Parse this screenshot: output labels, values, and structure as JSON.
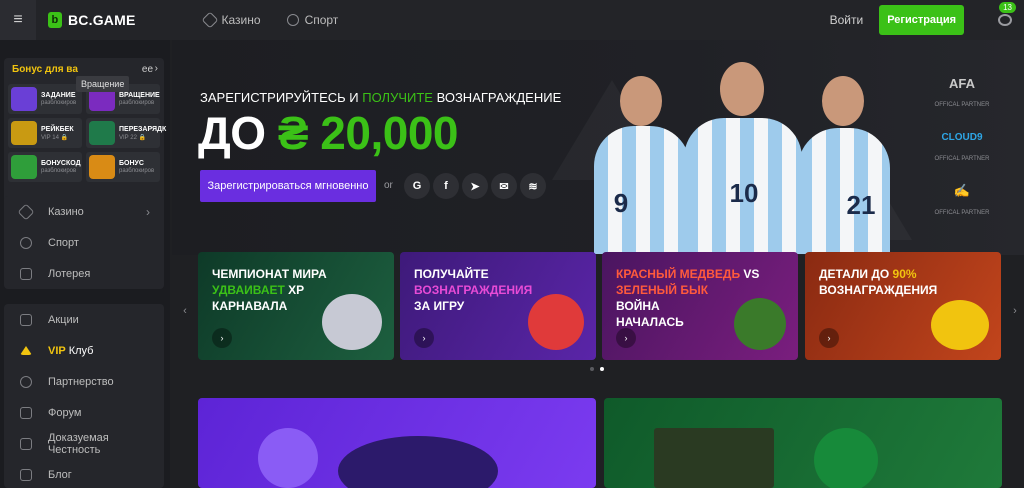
{
  "header": {
    "logo_text": "BC.GAME",
    "nav": [
      {
        "label": "Казино",
        "icon": "diamond-icon"
      },
      {
        "label": "Спорт",
        "icon": "ball-icon"
      }
    ],
    "login_label": "Войти",
    "register_label": "Регистрация",
    "chat_badge": "13"
  },
  "sidebar": {
    "bonus_title": "Бонус для ва",
    "bonus_title_tail": "ее",
    "tooltip": "Вращение",
    "bonus_tiles": [
      {
        "name": "ЗАДАНИЕ",
        "sub": "разблокиров",
        "color": "#6a3fd6"
      },
      {
        "name": "ВРАЩЕНИЕ",
        "sub": "разблокиров",
        "color": "#7b2bbf"
      },
      {
        "name": "РЕЙКБЕК",
        "sub": "VIP 14 🔒",
        "color": "#c99a12"
      },
      {
        "name": "ПЕРЕЗАРЯДК",
        "sub": "VIP 22 🔒",
        "color": "#1f7a4a"
      },
      {
        "name": "БОНУСКОД",
        "sub": "разблокиров",
        "color": "#2f9e3a"
      },
      {
        "name": "БОНУС",
        "sub": "разблокиров",
        "color": "#d98b15"
      }
    ],
    "group1": [
      {
        "label": "Казино",
        "arrow": "›"
      },
      {
        "label": "Спорт"
      },
      {
        "label": "Лотерея"
      }
    ],
    "group2": [
      {
        "label": "Акции"
      },
      {
        "label_vip": "VIP",
        "label": "Клуб"
      },
      {
        "label": "Партнерство"
      },
      {
        "label": "Форум"
      },
      {
        "label": "Доказуемая Честность"
      },
      {
        "label": "Блог"
      }
    ]
  },
  "hero": {
    "sub_a": "ЗАРЕГИСТРИРУЙТЕСЬ И ",
    "sub_b": "ПОЛУЧИТЕ",
    "sub_c": " ВОЗНАГРАЖДЕНИЕ",
    "amount_a": "ДО ",
    "amount_b": "₴ 20,000",
    "cta_label": "Зарегистрироваться мгновенно",
    "or_label": "or",
    "socials": [
      "G",
      "f",
      "➤",
      "✉",
      "≋"
    ],
    "player_numbers": [
      "9",
      "10",
      "21"
    ],
    "partners": [
      {
        "logo": "AFA",
        "caption": "OFFICAL PARTNER"
      },
      {
        "logo": "CLOUD9",
        "caption": "OFFICAL PARTNER"
      },
      {
        "logo": "✍",
        "caption": "OFFICAL PARTNER"
      }
    ]
  },
  "promos": [
    {
      "l1": "ЧЕМПИОНАТ МИРА",
      "l2": "УДВАИВАЕТ",
      "l2b": " XP",
      "l3": "КАРНАВАЛА",
      "bg": "#1d5f3f",
      "art": "#c7c9d4"
    },
    {
      "l1": "ПОЛУЧАЙТЕ",
      "l2": "ВОЗНАГРАЖДЕНИЯ",
      "l3": "ЗА ИГРУ",
      "bg": "#5a25a8",
      "art": "#e03a3a"
    },
    {
      "l1": "КРАСНЫЙ МЕДВЕДЬ",
      "l1b": " VS",
      "l2": "ЗЕЛЕНЫЙ БЫК",
      "l3": "ВОЙНА",
      "l4": "НАЧАЛАСЬ",
      "bg": "#7a1e7e",
      "art": "#3a7a2a"
    },
    {
      "l1": "ДЕТАЛИ ДО ",
      "l1b": "90%",
      "l2": "ВОЗНАГРАЖДЕНИЯ",
      "bg": "#c2451c",
      "art": "#f1c40f"
    }
  ],
  "promo_go": "›",
  "arrows": {
    "left": "‹",
    "right": "›"
  },
  "colors": {
    "accent": "#3bc117",
    "cta": "#6a2ee0",
    "vip": "#f1c40f"
  }
}
